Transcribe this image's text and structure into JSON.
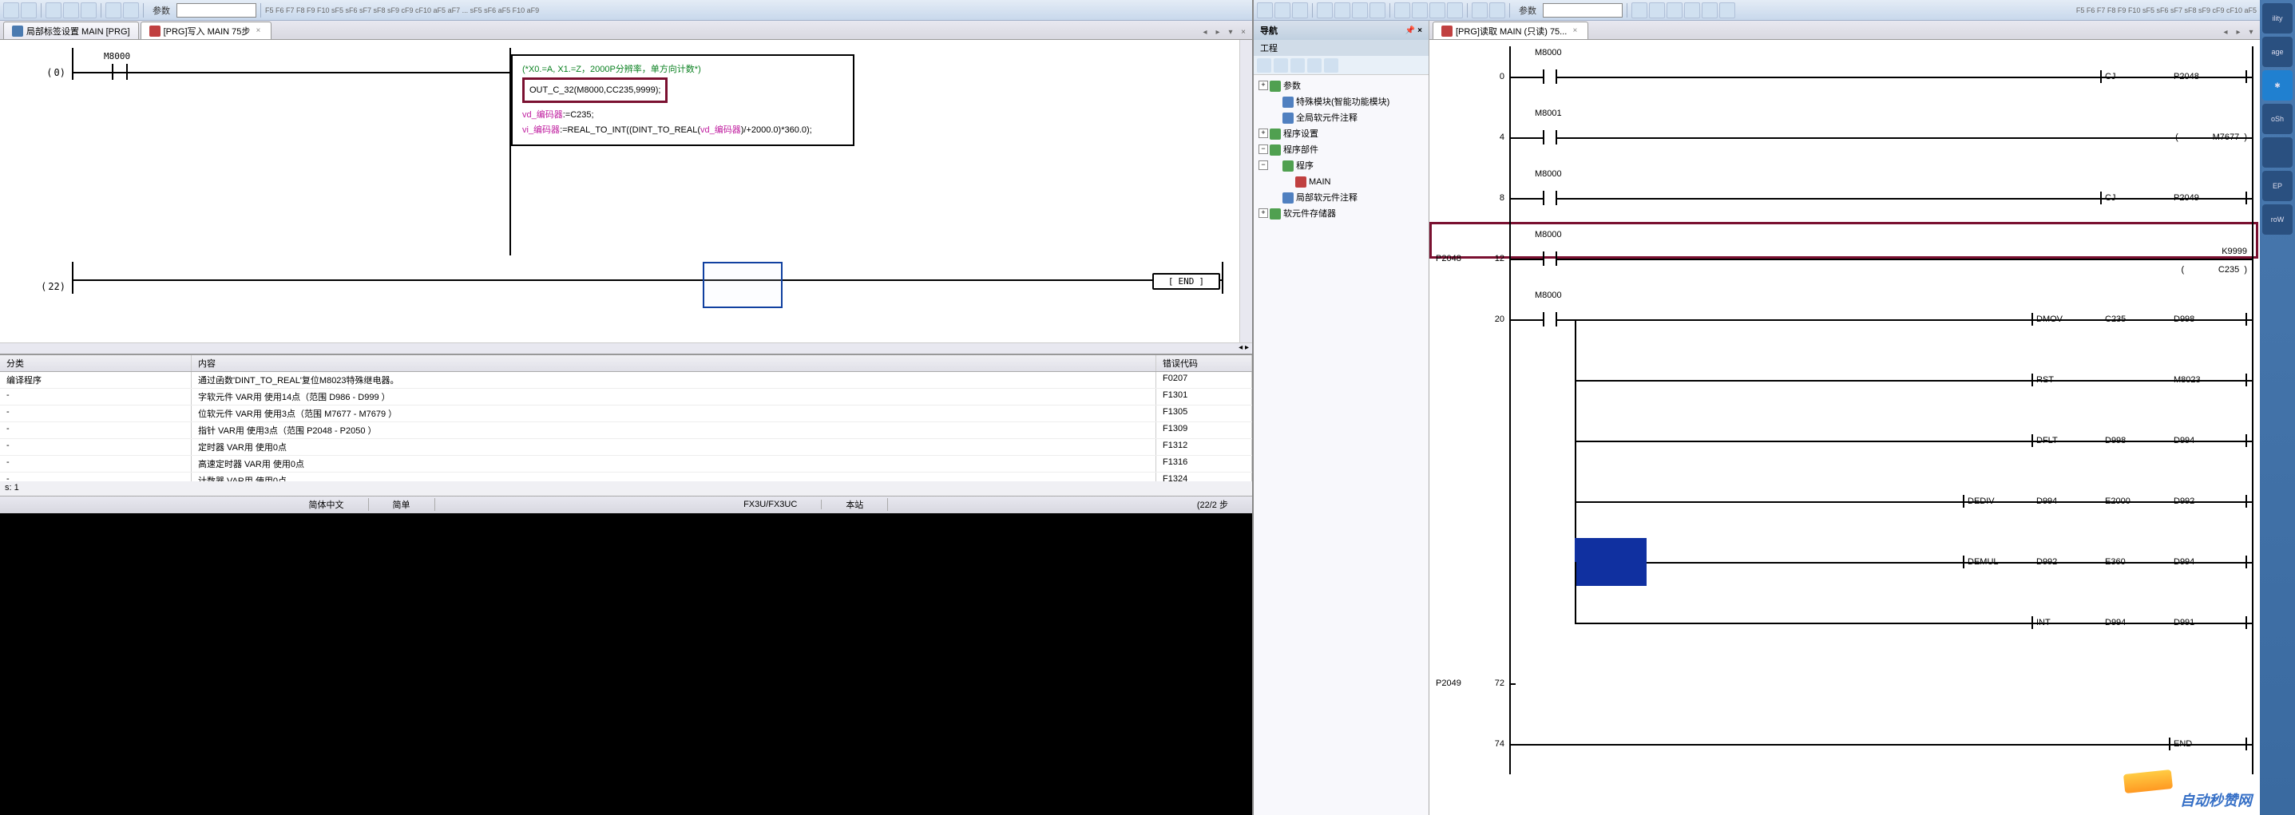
{
  "left": {
    "toolbar": {
      "param_label": "参数"
    },
    "tabs": [
      {
        "label": "局部标签设置 MAIN [PRG]",
        "active": false
      },
      {
        "label": "[PRG]写入 MAIN 75步",
        "active": true
      }
    ],
    "ladder": {
      "rungs": [
        {
          "step": "0",
          "contact": "M8000"
        },
        {
          "step": "22",
          "end": "END"
        }
      ],
      "code": {
        "comment": "(*X0.=A, X1.=Z，2000P分辨率，单方向计数*)",
        "out_call": "OUT_C_32(M8000,CC235,9999);",
        "line2_var": "vd_编码器",
        "line2_rest": ":=C235;",
        "line3_var1": "vi_编码器",
        "line3_mid": ":=REAL_TO_INT((DINT_TO_REAL(",
        "line3_var2": "vd_编码器",
        "line3_end": ")/+2000.0)*360.0);"
      }
    },
    "grid": {
      "columns": [
        "分类",
        "内容",
        "错误代码"
      ],
      "rows": [
        [
          "编译程序",
          "通过函数'DINT_TO_REAL'复位M8023特殊继电器。",
          "F0207"
        ],
        [
          "-",
          "字软元件 VAR用 使用14点（范围 D986 - D999 ）",
          "F1301"
        ],
        [
          "-",
          "位软元件 VAR用 使用3点（范围 M7677 - M7679 ）",
          "F1305"
        ],
        [
          "-",
          "指针 VAR用 使用3点（范围 P2048 - P2050 ）",
          "F1309"
        ],
        [
          "-",
          "定时器 VAR用 使用0点",
          "F1312"
        ],
        [
          "-",
          "高速定时器 VAR用 使用0点",
          "F1316"
        ],
        [
          "-",
          "计数器 VAR用 使用0点",
          "F1324"
        ]
      ]
    },
    "status_left": "s: 1",
    "status": [
      "简体中文",
      "简单",
      "FX3U/FX3UC",
      "本站",
      "(22/2 步"
    ]
  },
  "right": {
    "toolbar": {
      "param_label": "参数"
    },
    "nav": {
      "title": "导航",
      "section": "工程",
      "tree": [
        {
          "t": "col",
          "icon": "grn",
          "label": "参数",
          "d": 0
        },
        {
          "t": "leaf",
          "icon": "blu",
          "label": "特殊模块(智能功能模块)",
          "d": 1
        },
        {
          "t": "leaf",
          "icon": "blu",
          "label": "全局软元件注释",
          "d": 1
        },
        {
          "t": "col",
          "icon": "grn",
          "label": "程序设置",
          "d": 0
        },
        {
          "t": "exp",
          "icon": "grn",
          "label": "程序部件",
          "d": 0
        },
        {
          "t": "exp",
          "icon": "grn",
          "label": "程序",
          "d": 1
        },
        {
          "t": "leaf",
          "icon": "red",
          "label": "MAIN",
          "d": 2
        },
        {
          "t": "leaf",
          "icon": "blu",
          "label": "局部软元件注释",
          "d": 1
        },
        {
          "t": "col",
          "icon": "grn",
          "label": "软元件存储器",
          "d": 0
        }
      ]
    },
    "tab": "[PRG]读取 MAIN (只读) 75...",
    "ladder": {
      "rows": [
        {
          "step": "0",
          "contact": "M8000",
          "coil": [
            "CJ",
            "P2048"
          ]
        },
        {
          "step": "4",
          "contact": "M8001",
          "coil": [
            "",
            "M7677"
          ],
          "paren": true
        },
        {
          "step": "8",
          "contact": "M8000",
          "coil": [
            "CJ",
            "P2049"
          ]
        },
        {
          "step": "12",
          "contact": "M8000",
          "coil": [
            "K9999",
            "C235"
          ],
          "label": "P2048",
          "hl": true,
          "paren2": true
        },
        {
          "step": "20",
          "contact": "M8000",
          "coil": [
            "DMOV",
            "C235",
            "D998"
          ]
        },
        {
          "step": "",
          "contact": "",
          "coil": [
            "RST",
            "",
            "M8023"
          ],
          "branch": true
        },
        {
          "step": "",
          "contact": "",
          "coil": [
            "DFLT",
            "D998",
            "D994"
          ],
          "branch": true
        },
        {
          "step": "",
          "contact": "",
          "coil": [
            "DEDIV",
            "D994",
            "E2000",
            "D992"
          ],
          "branch": true
        },
        {
          "step": "",
          "contact": "",
          "coil": [
            "DEMUL",
            "D992",
            "E360",
            "D994"
          ],
          "branch": true,
          "sel": true
        },
        {
          "step": "",
          "contact": "",
          "coil": [
            "INT",
            "D994",
            "D991"
          ],
          "branch": true
        },
        {
          "step": "72",
          "contact": "",
          "coil": [],
          "label": "P2049"
        },
        {
          "step": "74",
          "contact": "",
          "coil": [
            "END"
          ],
          "end": true
        }
      ]
    }
  },
  "watermark": "自动秒赞网",
  "side_icons": [
    "ility",
    "age",
    "",
    "oSh",
    "",
    "EP",
    "roW"
  ]
}
